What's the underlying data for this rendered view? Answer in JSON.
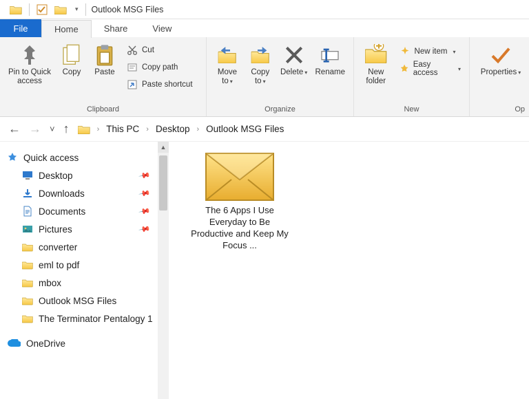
{
  "window": {
    "title": "Outlook MSG Files"
  },
  "tabrow": {
    "file": "File",
    "tabs": [
      {
        "label": "Home",
        "active": true
      },
      {
        "label": "Share",
        "active": false
      },
      {
        "label": "View",
        "active": false
      }
    ]
  },
  "ribbon": {
    "groups": {
      "clipboard": {
        "label": "Clipboard",
        "pin": {
          "label": "Pin to Quick access"
        },
        "copy": {
          "label": "Copy"
        },
        "paste": {
          "label": "Paste"
        },
        "cut": {
          "label": "Cut"
        },
        "copy_path": {
          "label": "Copy path"
        },
        "paste_shortcut": {
          "label": "Paste shortcut"
        }
      },
      "organize": {
        "label": "Organize",
        "move_to": {
          "label": "Move to"
        },
        "copy_to": {
          "label": "Copy to"
        },
        "delete": {
          "label": "Delete"
        },
        "rename": {
          "label": "Rename"
        }
      },
      "new": {
        "label": "New",
        "new_folder": {
          "label": "New folder"
        },
        "new_item": {
          "label": "New item"
        },
        "easy_access": {
          "label": "Easy access"
        }
      },
      "open": {
        "label": "Op",
        "properties": {
          "label": "Properties"
        }
      }
    }
  },
  "breadcrumb": {
    "parts": [
      "This PC",
      "Desktop",
      "Outlook MSG Files"
    ]
  },
  "nav": {
    "quick_access": {
      "label": "Quick access"
    },
    "pinned": [
      {
        "label": "Desktop",
        "pin": true,
        "icon": "monitor"
      },
      {
        "label": "Downloads",
        "pin": true,
        "icon": "download"
      },
      {
        "label": "Documents",
        "pin": true,
        "icon": "document"
      },
      {
        "label": "Pictures",
        "pin": true,
        "icon": "image"
      },
      {
        "label": "converter",
        "pin": false,
        "icon": "folder"
      },
      {
        "label": "eml to pdf",
        "pin": false,
        "icon": "folder"
      },
      {
        "label": "mbox",
        "pin": false,
        "icon": "folder"
      },
      {
        "label": "Outlook MSG Files",
        "pin": false,
        "icon": "folder"
      },
      {
        "label": "The Terminator Pentalogy 1",
        "pin": false,
        "icon": "folder"
      }
    ],
    "onedrive": {
      "label": "OneDrive"
    }
  },
  "content": {
    "items": [
      {
        "label": "The 6 Apps I Use Everyday to Be Productive and Keep My Focus ...",
        "icon": "envelope"
      }
    ]
  }
}
